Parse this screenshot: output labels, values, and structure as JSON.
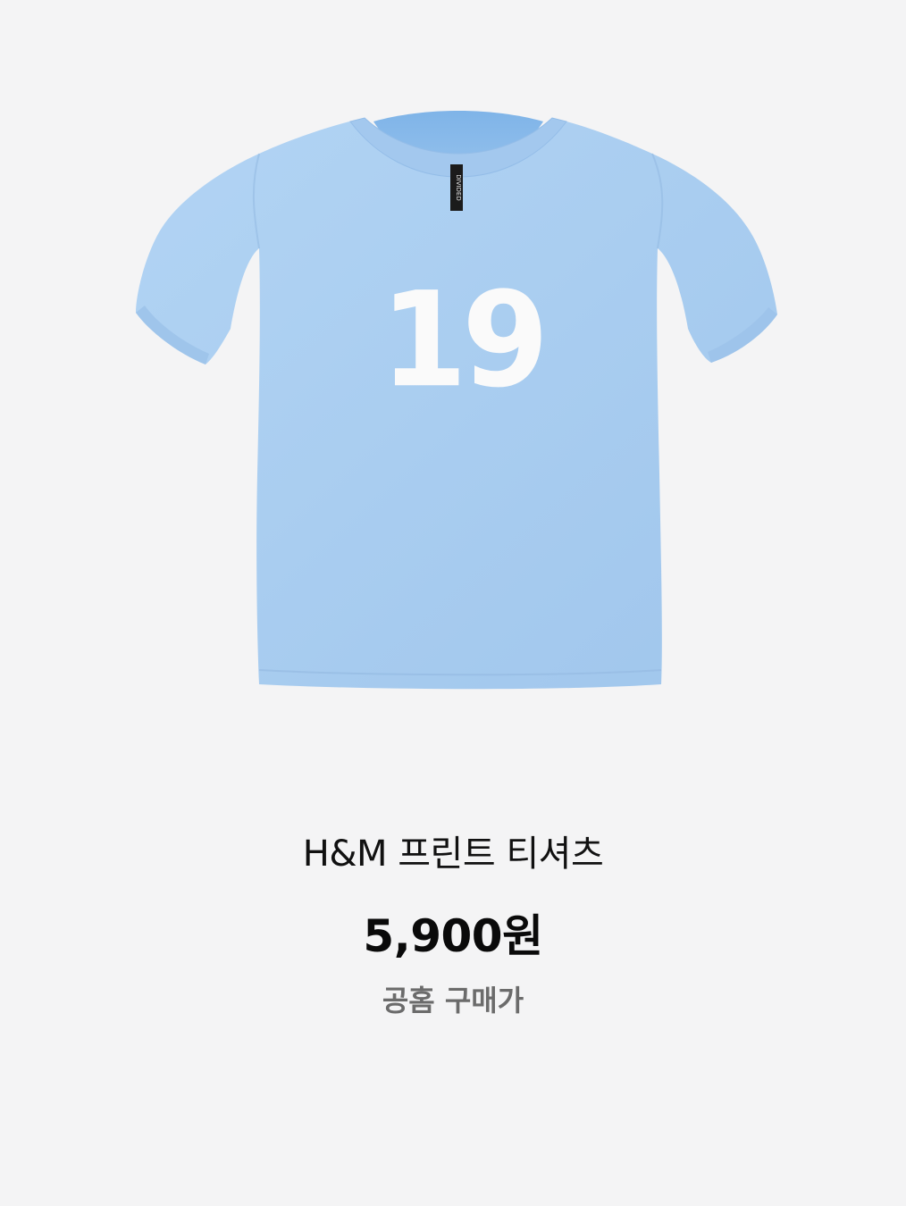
{
  "product": {
    "name": "H&M 프린트 티셔츠",
    "price": "5,900원",
    "price_note": "공홈 구매가",
    "image": {
      "subject": "tshirt-image",
      "print_text": "19",
      "neck_label_text": "DIVIDED",
      "shirt_color": "#a9cdf0",
      "print_color": "#fafafa"
    }
  },
  "colors": {
    "background": "#f4f4f5",
    "name_text": "#111111",
    "price_text": "#0a0a0a",
    "note_text": "#6b6b6b"
  }
}
